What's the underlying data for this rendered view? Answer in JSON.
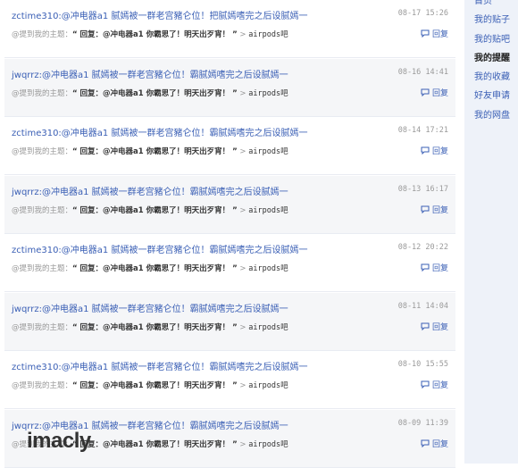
{
  "sidebar": {
    "items": [
      {
        "label": "首页",
        "active": false
      },
      {
        "label": "我的贴子",
        "active": false
      },
      {
        "label": "我的贴吧",
        "active": false
      },
      {
        "label": "我的提醒",
        "active": true
      },
      {
        "label": "我的收藏",
        "active": false
      },
      {
        "label": "好友申请",
        "active": false
      },
      {
        "label": "我的网盘",
        "active": false
      }
    ]
  },
  "feed": {
    "reply_label": "回复",
    "mention_prefix": "@提到我的主题：",
    "items": [
      {
        "user": "zctime310:",
        "message": "@冲电器a1 腻嫣被一群老宫豬仑位！把腻嫣嗜完之后设腻嫣一",
        "time": "08-17 15:26",
        "quote": "“ 回复：@冲电器a1 你霸思了！明天出歹宵！ ”",
        "forum": "airpods吧"
      },
      {
        "user": "jwqrrz:",
        "message": "@冲电器a1 腻嫣被一群老宫豬仑位！霸腻嫣嗜完之后设腻嫣一",
        "time": "08-16 14:41",
        "quote": "“ 回复：@冲电器a1 你霸思了！明天出歹宵！ ”",
        "forum": "airpods吧"
      },
      {
        "user": "zctime310:",
        "message": "@冲电器a1 腻嫣被一群老宫豬仑位！霸腻嫣嗜完之后设腻嫣一",
        "time": "08-14 17:21",
        "quote": "“ 回复：@冲电器a1 你霸思了！明天出歹宵！ ”",
        "forum": "airpods吧"
      },
      {
        "user": "jwqrrz:",
        "message": "@冲电器a1 腻嫣被一群老宫豬仑位！霸腻嫣嗜完之后设腻嫣一",
        "time": "08-13 16:17",
        "quote": "“ 回复：@冲电器a1 你霸思了！明天出歹宵！ ”",
        "forum": "airpods吧"
      },
      {
        "user": "zctime310:",
        "message": "@冲电器a1 腻嫣被一群老宫豬仑位！霸腻嫣嗜完之后设腻嫣一",
        "time": "08-12 20:22",
        "quote": "“ 回复：@冲电器a1 你霸思了！明天出歹宵！ ”",
        "forum": "airpods吧"
      },
      {
        "user": "jwqrrz:",
        "message": "@冲电器a1 腻嫣被一群老宫豬仑位！霸腻嫣嗜完之后设腻嫣一",
        "time": "08-11 14:04",
        "quote": "“ 回复：@冲电器a1 你霸思了！明天出歹宵！ ”",
        "forum": "airpods吧"
      },
      {
        "user": "zctime310:",
        "message": "@冲电器a1 腻嫣被一群老宫豬仑位！霸腻嫣嗜完之后设腻嫣一",
        "time": "08-10 15:55",
        "quote": "“ 回复：@冲电器a1 你霸思了！明天出歹宵！ ”",
        "forum": "airpods吧"
      },
      {
        "user": "jwqrrz:",
        "message": "@冲电器a1 腻嫣被一群老宫豬仑位！霸腻嫣嗜完之后设腻嫣一",
        "time": "08-09 11:39",
        "quote": "“ 回复：@冲电器a1 你霸思了！明天出歹宵！ ”",
        "forum": "airpods吧"
      }
    ]
  },
  "watermark": {
    "text": "imacly"
  },
  "colors": {
    "link": "#3a5fb5",
    "sidebar_bg": "#eef2f9",
    "alt_row": "#f5f6f8"
  }
}
